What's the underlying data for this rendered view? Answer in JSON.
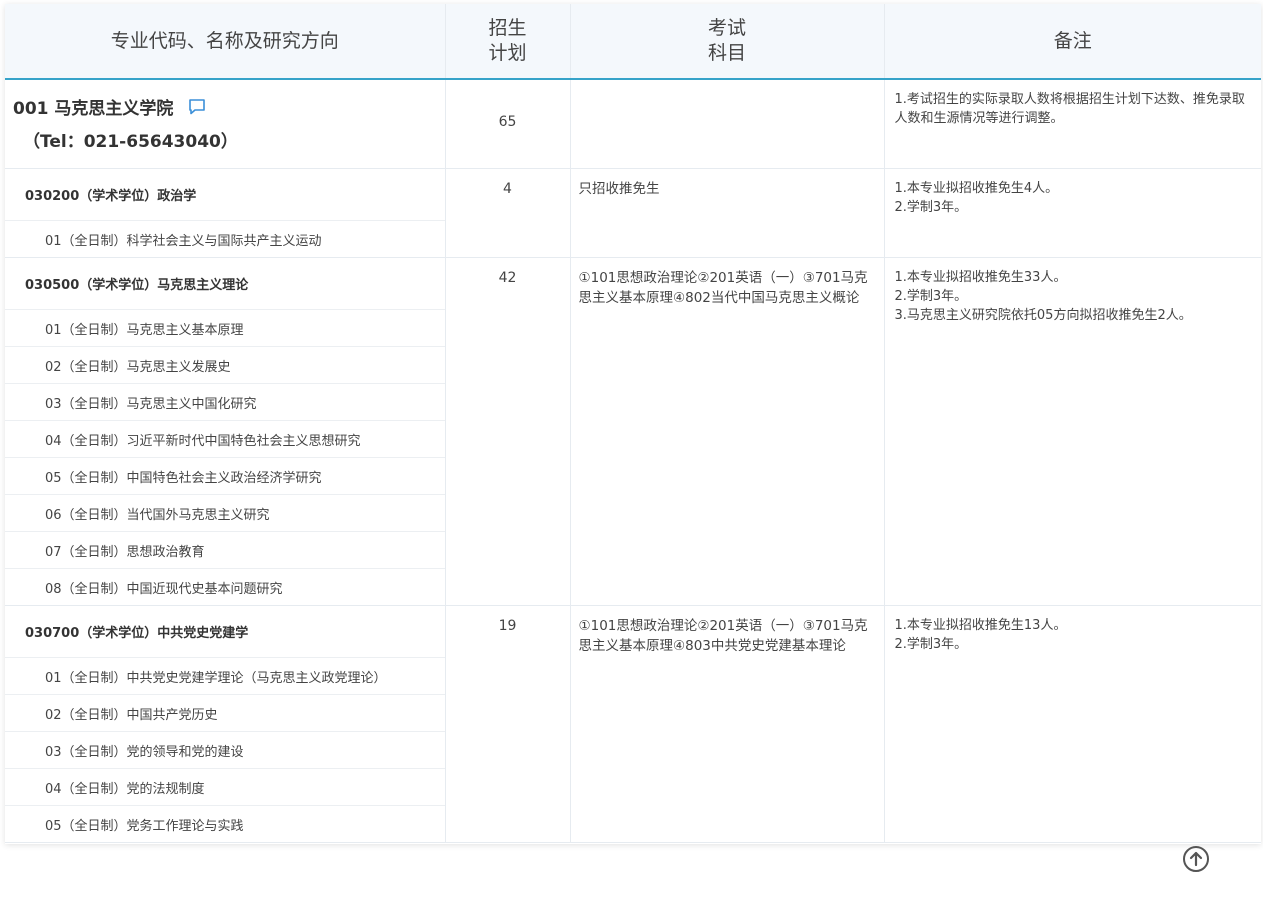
{
  "header": {
    "col1": "专业代码、名称及研究方向",
    "col2_line1": "招生",
    "col2_line2": "计划",
    "col3_line1": "考试",
    "col3_line2": "科目",
    "col4": "备注"
  },
  "college": {
    "name": "001 马克思主义学院",
    "tel": "（Tel：021-65643040）",
    "plan": "65",
    "subjects": "",
    "note": "1.考试招生的实际录取人数将根据招生计划下达数、推免录取人数和生源情况等进行调整。",
    "chat_icon": "chat-bubble-icon"
  },
  "majors": [
    {
      "title": "030200（学术学位）政治学",
      "plan": "4",
      "subjects": "只招收推免生",
      "notes": [
        "1.本专业拟招收推免生4人。",
        "2.学制3年。"
      ],
      "directions": [
        "01（全日制）科学社会主义与国际共产主义运动"
      ]
    },
    {
      "title": "030500（学术学位）马克思主义理论",
      "plan": "42",
      "subjects": "①101思想政治理论②201英语（一）③701马克思主义基本原理④802当代中国马克思主义概论",
      "notes": [
        "1.本专业拟招收推免生33人。",
        "2.学制3年。",
        "3.马克思主义研究院依托05方向拟招收推免生2人。"
      ],
      "directions": [
        "01（全日制）马克思主义基本原理",
        "02（全日制）马克思主义发展史",
        "03（全日制）马克思主义中国化研究",
        "04（全日制）习近平新时代中国特色社会主义思想研究",
        "05（全日制）中国特色社会主义政治经济学研究",
        "06（全日制）当代国外马克思主义研究",
        "07（全日制）思想政治教育",
        "08（全日制）中国近现代史基本问题研究"
      ]
    },
    {
      "title": "030700（学术学位）中共党史党建学",
      "plan": "19",
      "subjects": "①101思想政治理论②201英语（一）③701马克思主义基本原理④803中共党史党建基本理论",
      "notes": [
        "1.本专业拟招收推免生13人。",
        "2.学制3年。"
      ],
      "directions": [
        "01（全日制）中共党史党建学理论（马克思主义政党理论）",
        "02（全日制）中国共产党历史",
        "03（全日制）党的领导和党的建设",
        "04（全日制）党的法规制度",
        "05（全日制）党务工作理论与实践"
      ]
    }
  ],
  "back_to_top_icon": "arrow-up-circle-icon"
}
